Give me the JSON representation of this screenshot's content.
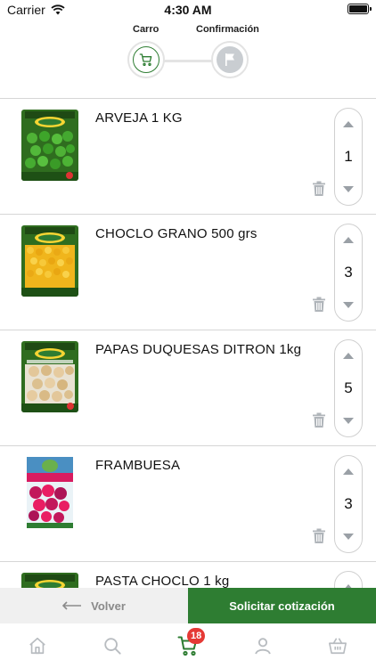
{
  "status_bar": {
    "carrier": "Carrier",
    "time": "4:30 AM"
  },
  "stepper": {
    "steps": [
      {
        "label": "Carro",
        "state": "active"
      },
      {
        "label": "Confirmación",
        "state": "inactive"
      }
    ]
  },
  "cart": {
    "items": [
      {
        "name": "ARVEJA 1 KG",
        "quantity": "1",
        "image": "peas-bag"
      },
      {
        "name": "CHOCLO GRANO 500 grs",
        "quantity": "3",
        "image": "corn-bag"
      },
      {
        "name": "PAPAS DUQUESAS DITRON 1kg",
        "quantity": "5",
        "image": "potato-bag"
      },
      {
        "name": "FRAMBUESA",
        "quantity": "3",
        "image": "raspberry-bag"
      },
      {
        "name": "PASTA CHOCLO 1 kg",
        "quantity": "",
        "image": "corn-paste-bag"
      }
    ]
  },
  "actions": {
    "back_label": "Volver",
    "quote_label": "Solicitar cotización"
  },
  "tab_bar": {
    "items": [
      {
        "name": "home-icon"
      },
      {
        "name": "search-icon"
      },
      {
        "name": "cart-icon",
        "active": true
      },
      {
        "name": "user-icon"
      },
      {
        "name": "basket-icon"
      }
    ],
    "cart_badge": "18"
  },
  "colors": {
    "brand_green": "#2e7d32",
    "badge_red": "#e53935",
    "muted": "#9aa0a6"
  }
}
